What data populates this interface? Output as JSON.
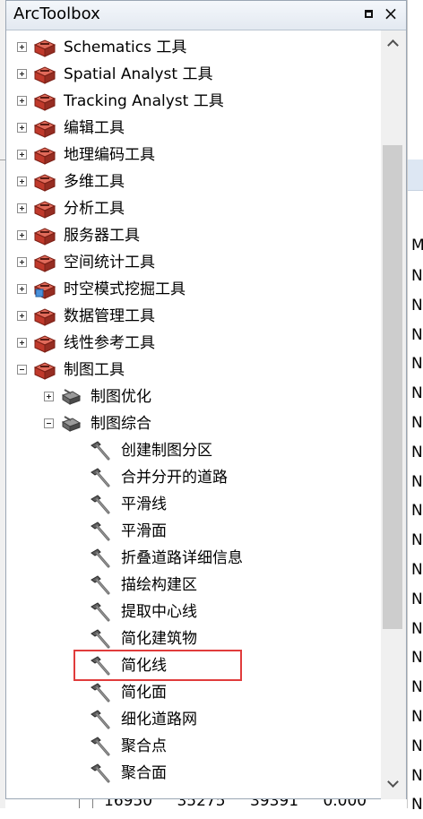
{
  "window": {
    "title": "ArcToolbox",
    "restore_icon": "restore-icon",
    "close_glyph": "×"
  },
  "colors": {
    "toolbox_red": "#c0392b",
    "highlight_border": "#e03c3c",
    "scrollbar_thumb": "#cdcdcd"
  },
  "toolboxes": [
    {
      "label": "Schematics 工具",
      "expanded": false
    },
    {
      "label": "Spatial Analyst 工具",
      "expanded": false
    },
    {
      "label": "Tracking Analyst 工具",
      "expanded": false
    },
    {
      "label": "编辑工具",
      "expanded": false
    },
    {
      "label": "地理编码工具",
      "expanded": false
    },
    {
      "label": "多维工具",
      "expanded": false
    },
    {
      "label": "分析工具",
      "expanded": false
    },
    {
      "label": "服务器工具",
      "expanded": false
    },
    {
      "label": "空间统计工具",
      "expanded": false
    },
    {
      "label": "时空模式挖掘工具",
      "expanded": false
    },
    {
      "label": "数据管理工具",
      "expanded": false
    },
    {
      "label": "线性参考工具",
      "expanded": false
    },
    {
      "label": "制图工具",
      "expanded": true
    }
  ],
  "toolsets": [
    {
      "label": "制图优化",
      "expanded": false
    },
    {
      "label": "制图综合",
      "expanded": true
    }
  ],
  "tools": [
    {
      "label": "创建制图分区"
    },
    {
      "label": "合并分开的道路"
    },
    {
      "label": "平滑线"
    },
    {
      "label": "平滑面"
    },
    {
      "label": "折叠道路详细信息"
    },
    {
      "label": "描绘构建区"
    },
    {
      "label": "提取中心线"
    },
    {
      "label": "简化建筑物"
    },
    {
      "label": "简化线",
      "highlighted": true
    },
    {
      "label": "简化面"
    },
    {
      "label": "细化道路网"
    },
    {
      "label": "聚合点"
    },
    {
      "label": "聚合面"
    }
  ],
  "bottom_partial": {
    "values": "16950 35275 39391 0.000"
  },
  "right_panel": {
    "header": "M",
    "cells": [
      "N",
      "N",
      "N",
      "N",
      "N",
      "N",
      "N",
      "N",
      "N",
      "N",
      "N",
      "N",
      "N",
      "N",
      "N",
      "N",
      "N",
      "N",
      "N"
    ]
  }
}
